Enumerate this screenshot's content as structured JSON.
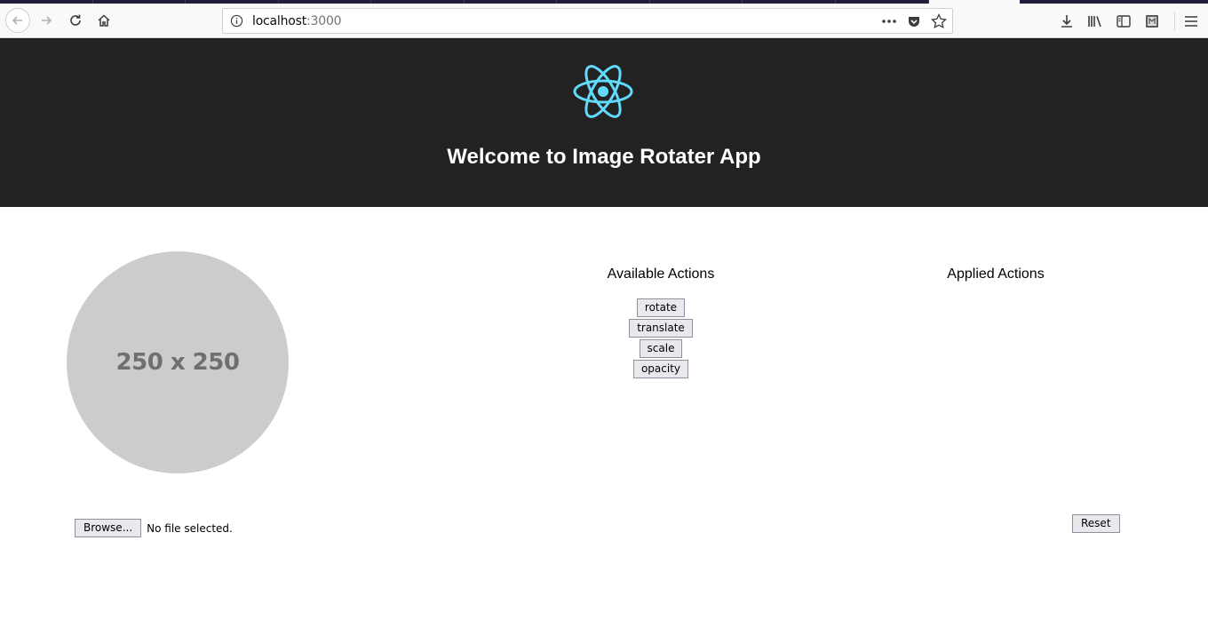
{
  "browser": {
    "url_host": "localhost",
    "url_port": ":3000",
    "icons": [
      "back-arrow",
      "forward-arrow",
      "reload",
      "home",
      "info",
      "more-dots",
      "pocket",
      "star",
      "download",
      "library",
      "sidebar",
      "extension",
      "hamburger-menu"
    ]
  },
  "header": {
    "title": "Welcome to Image Rotater App",
    "logo": "react-logo",
    "logo_color": "#61dafb",
    "background": "#222222"
  },
  "preview": {
    "label": "250 x 250"
  },
  "available": {
    "title": "Available Actions",
    "actions": [
      "rotate",
      "translate",
      "scale",
      "opacity"
    ]
  },
  "applied": {
    "title": "Applied Actions"
  },
  "file_input": {
    "button_label": "Browse...",
    "status": "No file selected."
  },
  "reset_label": "Reset"
}
